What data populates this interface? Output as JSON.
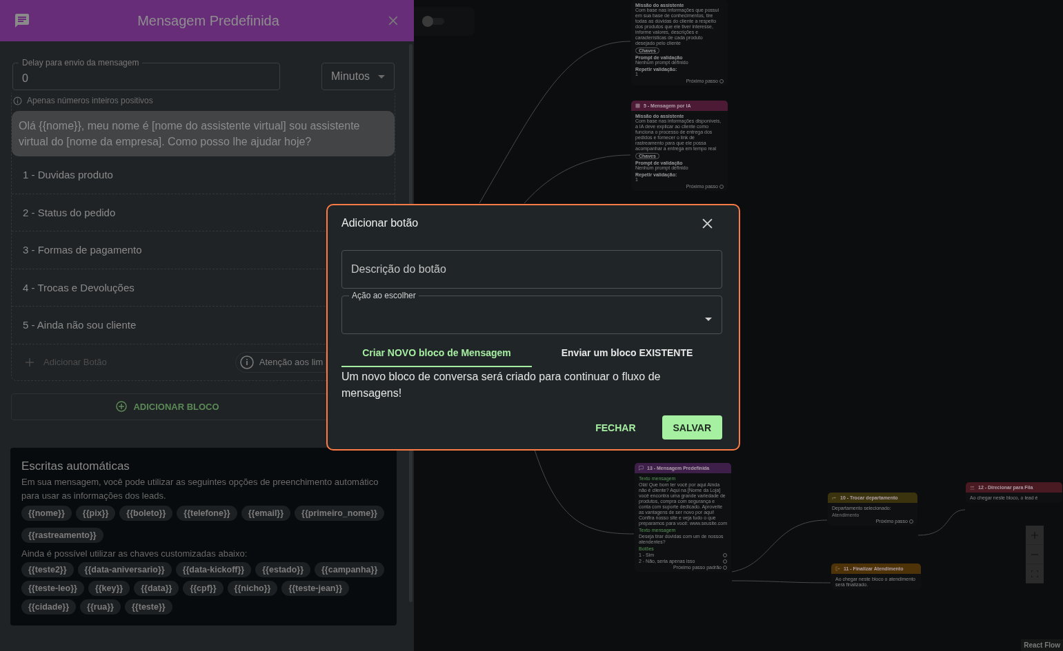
{
  "side_panel": {
    "title": "Mensagem Predefinida",
    "delay_field": {
      "label": "Delay para envio da mensagem",
      "value": "0"
    },
    "unit_select": {
      "value": "Minutos"
    },
    "helper_text": "Apenas números inteiros positivos",
    "message_text": "Olá {{nome}}, meu nome é [nome do assistente virtual] sou assistente virtual do [nome da empresa]. Como posso lhe ajudar hoje?",
    "buttons": [
      {
        "label": "1 - Duvidas produto"
      },
      {
        "label": "2 - Status do pedido"
      },
      {
        "label": "3 - Formas de pagamento"
      },
      {
        "label": "4 - Trocas e Devoluções"
      },
      {
        "label": "5 - Ainda não sou cliente"
      }
    ],
    "add_button_label": "Adicionar Botão",
    "warning_chip": "Atenção aos lim",
    "add_block_label": "ADICIONAR BLOCO"
  },
  "auto_fields": {
    "title": "Escritas automáticas",
    "description": "Em sua mensagem, você pode utilizar as seguintes opções de preenchimento automático para usar as informações dos leads.",
    "fields": [
      "{{nome}}",
      "{{pix}}",
      "{{boleto}}",
      "{{telefone}}",
      "{{email}}",
      "{{primeiro_nome}}",
      "{{rastreamento}}"
    ],
    "custom_label": "Ainda é possível utilizar as chaves customizadas abaixo:",
    "custom_fields": [
      "{{teste2}}",
      "{{data-aniversario}}",
      "{{data-kickoff}}",
      "{{estado}}",
      "{{campanha}}",
      "{{teste-leo}}",
      "{{key}}",
      "{{data}}",
      "{{cpf}}",
      "{{nicho}}",
      "{{teste-jean}}",
      "{{cidade}}",
      "{{rua}}",
      "{{teste}}"
    ]
  },
  "canvas": {
    "toggle": {
      "on": false
    },
    "nodes": [
      {
        "blocks": [
          {
            "kind": "field",
            "label": "Missão do assistente",
            "value": "Com base nas informações que possui em sua base de conhecimentos, tire todas as dúvidas do cliente a respeito dos produtos que ele tiver interesse, informe valores, descrições e características de cada produto desejado pelo cliente"
          },
          {
            "kind": "chip",
            "label": "Chaves"
          },
          {
            "kind": "field",
            "label": "Prompt de validação",
            "value": "Nenhum prompt definido"
          },
          {
            "kind": "field",
            "label": "Repetir validação:",
            "value": "1"
          },
          {
            "kind": "footer",
            "label": "Próximo passo"
          }
        ]
      },
      {
        "kind": "ai",
        "title": "5 - Mensagem por IA",
        "color": "#4d1a35",
        "blocks": [
          {
            "kind": "field",
            "label": "Missão do assistente",
            "value": "Com base nas informações disponíveis, a IA deve explicar ao cliente como funciona o processo de entrega dos pedidos e fornecer o link de rastreamento para que ele possa acompanhar a entrega em tempo real"
          },
          {
            "kind": "chip",
            "label": "Chaves"
          },
          {
            "kind": "field",
            "label": "Prompt de validação",
            "value": "Nenhum prompt definido"
          },
          {
            "kind": "field",
            "label": "Repetir validação:",
            "value": "1"
          },
          {
            "kind": "footer",
            "label": "Próximo passo"
          }
        ]
      },
      {
        "kind": "message",
        "title": "13 - Mensagem Predefinida",
        "color": "#3d1f4a",
        "blocks": [
          {
            "kind": "caption",
            "label": "Texto mensagem"
          },
          {
            "kind": "text",
            "label": "Olá! Que bom ter você por aqui Ainda não é cliente? Aqui na [Nome da Loja] você encontra uma grande variedade de produtos, compra com segurança e conta com suporte dedicado. Aproveite as vantagens de ser novo por aqui! Confira nosso site e veja tudo o que preparamos para você: www.seusite.com"
          },
          {
            "kind": "caption",
            "label": "Texto mensagem"
          },
          {
            "kind": "text",
            "label": "Deseja tirar dúvidas com um de nossos atendentes?"
          },
          {
            "kind": "caption",
            "label": "Botões"
          },
          {
            "kind": "option",
            "label": "1 - Sim"
          },
          {
            "kind": "option",
            "label": "2 - Não, seria apenas isso"
          },
          {
            "kind": "footer",
            "label": "Próximo passo padrão"
          }
        ]
      },
      {
        "kind": "department",
        "title": "10 - Trocar departamento",
        "color": "#3b330d",
        "blocks": [
          {
            "kind": "text",
            "label": "Departamento selecionado:"
          },
          {
            "kind": "small",
            "label": "Atendimento"
          },
          {
            "kind": "footer",
            "label": "Próximo passo"
          }
        ]
      },
      {
        "kind": "finish",
        "title": "11 - Finalizar Atendimento",
        "color": "#4f3308",
        "blocks": [
          {
            "kind": "text",
            "label": "Ao chegar neste bloco o atendimento será finalizado."
          }
        ]
      },
      {
        "kind": "queue",
        "title": "12 - Direcionar para Fila",
        "color": "#4a1a22",
        "blocks": [
          {
            "kind": "text",
            "label": "Ao chegar neste bloco, o lead é"
          }
        ]
      }
    ],
    "attribution": "React Flow"
  },
  "modal": {
    "title": "Adicionar botão",
    "description_field": {
      "placeholder": "Descrição do botão"
    },
    "action_select": {
      "label": "Ação ao escolher"
    },
    "tabs": [
      {
        "label": "Criar NOVO bloco de Mensagem",
        "selected": true
      },
      {
        "label": "Enviar um bloco EXISTENTE",
        "selected": false
      }
    ],
    "info": "Um novo bloco de conversa será criado para continuar o fluxo de mensagens!",
    "actions": [
      {
        "label": "FECHAR",
        "kind": "text"
      },
      {
        "label": "SALVAR",
        "kind": "primary"
      }
    ]
  }
}
